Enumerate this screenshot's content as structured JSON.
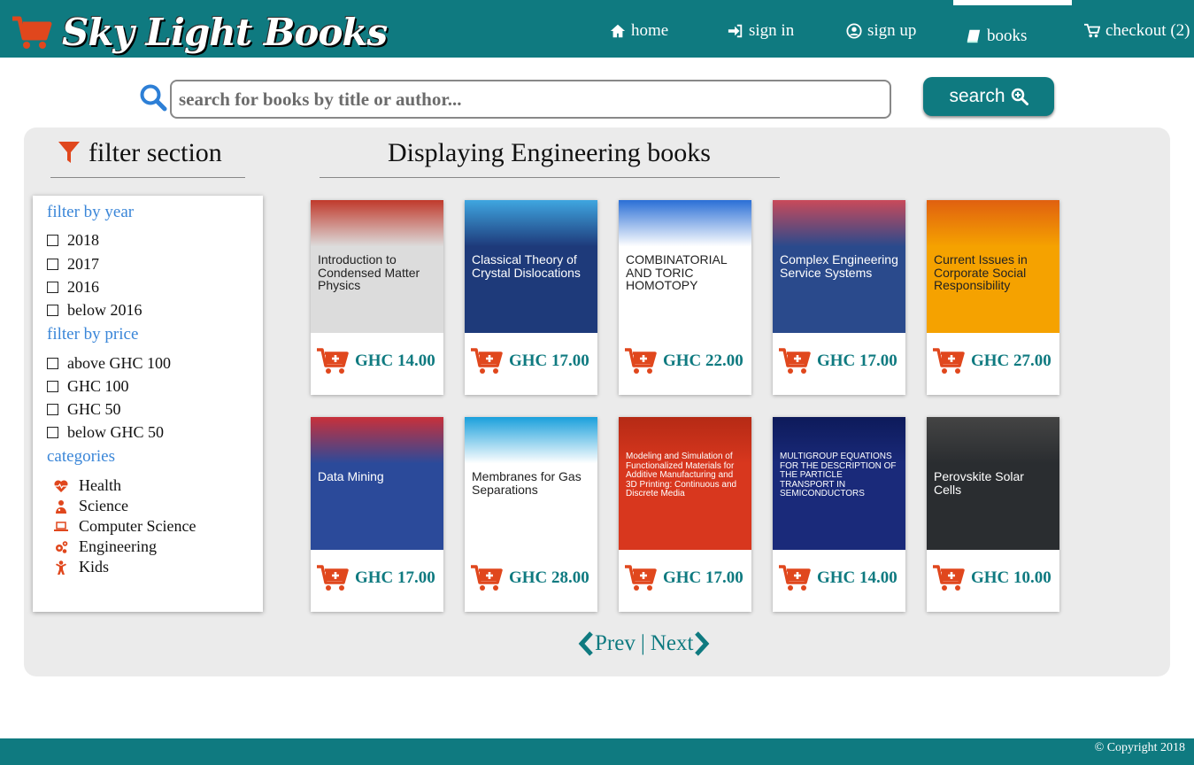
{
  "brand": {
    "name": "Sky Light Books"
  },
  "nav": {
    "home": "home",
    "sign_in": "sign in",
    "sign_up": "sign up",
    "books": "books",
    "checkout": "checkout (2)"
  },
  "search": {
    "placeholder": "search for books by title or author...",
    "button": "search"
  },
  "filter": {
    "heading": "filter section",
    "year_heading": "filter by year",
    "years": [
      "2018",
      "2017",
      "2016",
      "below 2016"
    ],
    "price_heading": "filter by price",
    "prices": [
      "above GHC 100",
      "GHC 100",
      "GHC 50",
      "below GHC 50"
    ],
    "categories_heading": "categories",
    "categories": [
      {
        "label": "Health",
        "icon": "heartbeat-icon"
      },
      {
        "label": "Science",
        "icon": "scientist-icon"
      },
      {
        "label": "Computer Science",
        "icon": "laptop-icon"
      },
      {
        "label": "Engineering",
        "icon": "gears-icon"
      },
      {
        "label": "Kids",
        "icon": "child-icon"
      }
    ]
  },
  "main": {
    "title": "Displaying Engineering books"
  },
  "books": [
    {
      "title": "Introduction to Condensed Matter Physics",
      "price": "GHC 14.00",
      "cover": "#dcdcdc",
      "accent": "#c0392b"
    },
    {
      "title": "Classical Theory of Crystal Dislocations",
      "price": "GHC 17.00",
      "cover": "#1e3a7a",
      "accent": "#3fa6e0"
    },
    {
      "title": "COMBINATORIAL AND TORIC HOMOTOPY",
      "price": "GHC 22.00",
      "cover": "#ffffff",
      "accent": "#2a6fd6"
    },
    {
      "title": "Complex Engineering Service Systems",
      "price": "GHC 17.00",
      "cover": "#2a4a8c",
      "accent": "#c94a5a"
    },
    {
      "title": "Current Issues in Corporate Social Responsibility",
      "price": "GHC 27.00",
      "cover": "#f5a200",
      "accent": "#e06010"
    },
    {
      "title": "Data Mining",
      "price": "GHC 17.00",
      "cover": "#2b4a9a",
      "accent": "#c8303a"
    },
    {
      "title": "Membranes for Gas Separations",
      "price": "GHC 28.00",
      "cover": "#ffffff",
      "accent": "#1aa0dc"
    },
    {
      "title": "Modeling and Simulation of Functionalized Materials for Additive Manufacturing and 3D Printing: Continuous and Discrete Media",
      "price": "GHC 17.00",
      "cover": "#d8371e",
      "accent": "#b52a15"
    },
    {
      "title": "MULTIGROUP EQUATIONS FOR THE DESCRIPTION OF THE PARTICLE TRANSPORT IN SEMICONDUCTORS",
      "price": "GHC 14.00",
      "cover": "#1a2a7a",
      "accent": "#0d1a5a"
    },
    {
      "title": "Perovskite Solar Cells",
      "price": "GHC 10.00",
      "cover": "#2a2d30",
      "accent": "#444"
    }
  ],
  "pager": {
    "prev": "Prev",
    "separator": "|",
    "next": "Next"
  },
  "footer": {
    "copyright": "© Copyright 2018"
  },
  "colors": {
    "teal": "#0f7a80",
    "orange": "#e0471d",
    "link_blue": "#3a86d8"
  }
}
